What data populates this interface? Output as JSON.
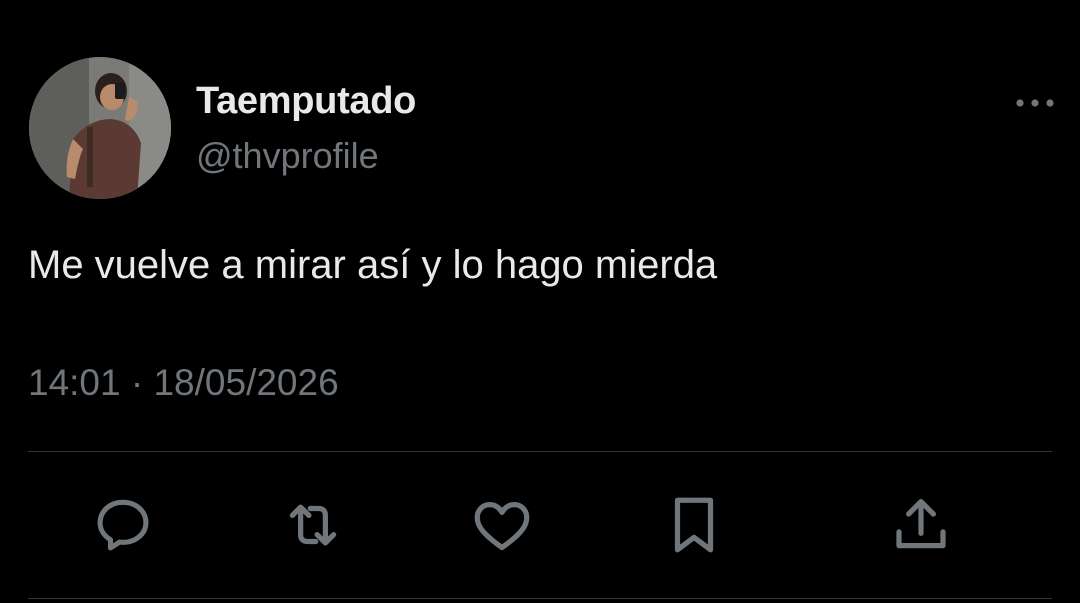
{
  "tweet": {
    "author": {
      "display_name": "Taemputado",
      "handle": "@thvprofile"
    },
    "text": "Me vuelve a mirar así y lo hago mierda",
    "time": "14:01",
    "separator": "·",
    "date": "18/05/2026"
  },
  "actions": [
    {
      "name": "reply",
      "icon": "reply-icon"
    },
    {
      "name": "retweet",
      "icon": "retweet-icon"
    },
    {
      "name": "like",
      "icon": "heart-icon"
    },
    {
      "name": "bookmark",
      "icon": "bookmark-icon"
    },
    {
      "name": "share",
      "icon": "share-icon"
    }
  ],
  "colors": {
    "background": "#000000",
    "primary_text": "#e7e9ea",
    "secondary_text": "#71767b",
    "divider": "#2f3336"
  }
}
